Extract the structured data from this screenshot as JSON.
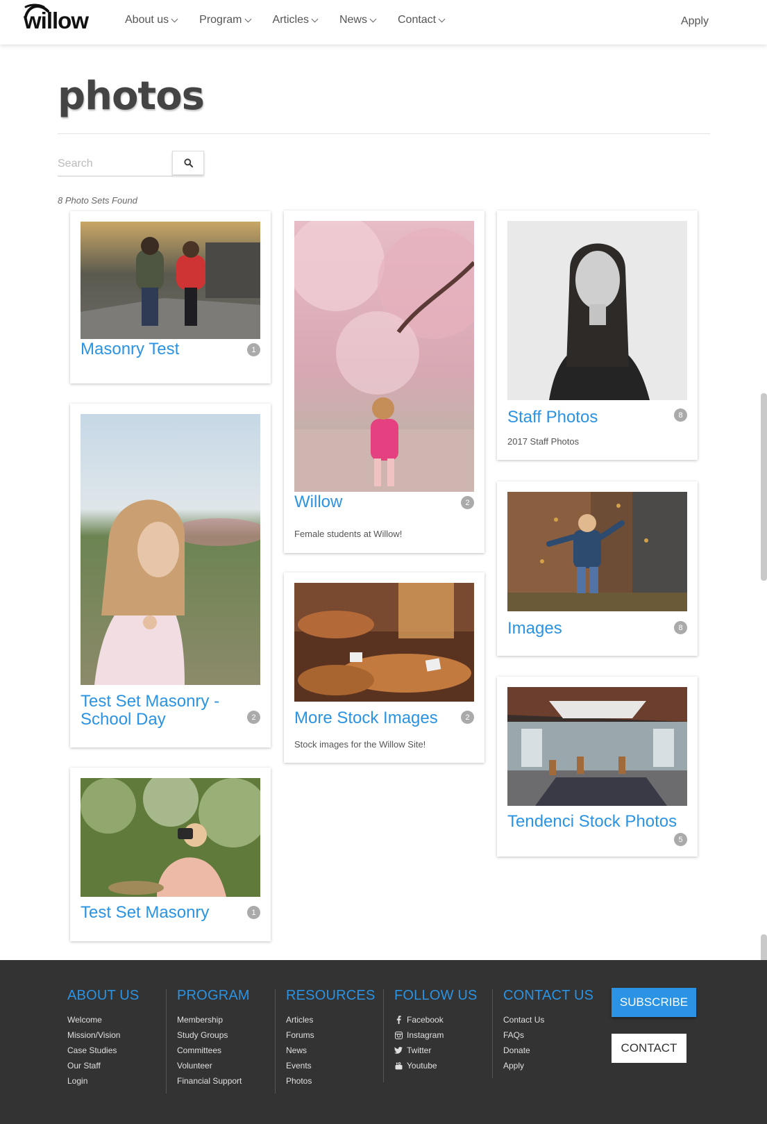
{
  "header": {
    "logo": "willow",
    "nav": [
      {
        "label": "About us"
      },
      {
        "label": "Program"
      },
      {
        "label": "Articles"
      },
      {
        "label": "News"
      },
      {
        "label": "Contact"
      }
    ],
    "apply": "Apply"
  },
  "page": {
    "title": "photos",
    "search_placeholder": "Search",
    "results": "8 Photo Sets Found"
  },
  "cards": [
    {
      "title": "Masonry Test",
      "count": "1",
      "desc": "",
      "image": "children-on-bridge"
    },
    {
      "title": "Willow",
      "count": "2",
      "desc": "Female students at Willow!",
      "image": "girl-cherry-blossoms"
    },
    {
      "title": "Staff Photos",
      "count": "8",
      "desc": "2017 Staff Photos",
      "image": "woman-portrait-bw"
    },
    {
      "title": "Test Set Masonry - School Day",
      "count": "2",
      "desc": "",
      "image": "girl-in-field"
    },
    {
      "title": "More Stock Images",
      "count": "2",
      "desc": "Stock images for the Willow Site!",
      "image": "bakery-pastries"
    },
    {
      "title": "Images",
      "count": "8",
      "desc": "",
      "image": "boy-with-leaves"
    },
    {
      "title": "Test Set Masonry",
      "count": "1",
      "desc": "",
      "image": "girl-with-camera"
    },
    {
      "title": "Tendenci Stock Photos",
      "count": "5",
      "desc": "",
      "image": "cafe-interior"
    }
  ],
  "footer": {
    "columns": [
      {
        "heading": "ABOUT US",
        "links": [
          "Welcome",
          "Mission/Vision",
          "Case Studies",
          "Our Staff",
          "Login"
        ]
      },
      {
        "heading": "PROGRAM",
        "links": [
          "Membership",
          "Study Groups",
          "Committees",
          "Volunteer",
          "Financial Support"
        ]
      },
      {
        "heading": "RESOURCES",
        "links": [
          "Articles",
          "Forums",
          "News",
          "Events",
          "Photos"
        ]
      },
      {
        "heading": "FOLLOW US",
        "links": [
          "Facebook",
          "Instagram",
          "Twitter",
          "Youtube"
        ],
        "icons": [
          "facebook-icon",
          "instagram-icon",
          "twitter-icon",
          "youtube-icon"
        ]
      },
      {
        "heading": "CONTACT US",
        "links": [
          "Contact Us",
          "FAQs",
          "Donate",
          "Apply"
        ]
      }
    ],
    "subscribe": "SUBSCRIBE",
    "contact": "CONTACT"
  },
  "colors": {
    "accent": "#2a93e3",
    "footer_bg": "#333333",
    "badge": "#aaaaaa"
  }
}
